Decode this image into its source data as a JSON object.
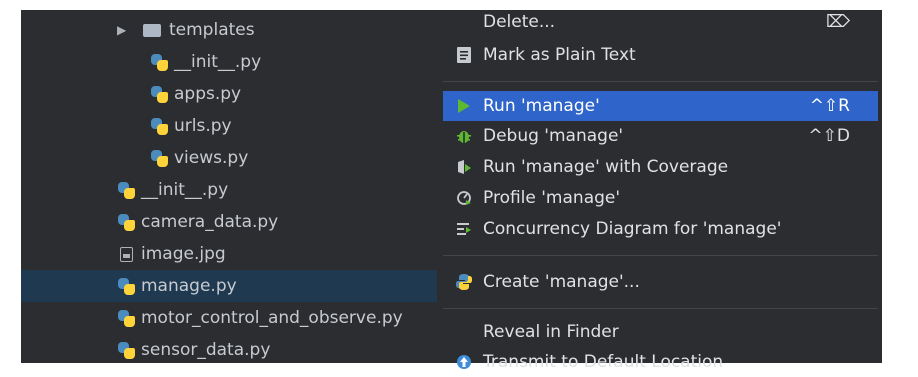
{
  "tree": {
    "items": [
      {
        "label": "templates",
        "type": "folder"
      },
      {
        "label": "__init__.py",
        "type": "py"
      },
      {
        "label": "apps.py",
        "type": "py"
      },
      {
        "label": "urls.py",
        "type": "py"
      },
      {
        "label": "views.py",
        "type": "py"
      },
      {
        "label": "__init__.py",
        "type": "py"
      },
      {
        "label": "camera_data.py",
        "type": "py"
      },
      {
        "label": "image.jpg",
        "type": "image"
      },
      {
        "label": "manage.py",
        "type": "py",
        "selected": true
      },
      {
        "label": "motor_control_and_observe.py",
        "type": "py"
      },
      {
        "label": "sensor_data.py",
        "type": "py"
      }
    ]
  },
  "menu": {
    "items": [
      {
        "label": "Delete...",
        "shortcut": "⌦",
        "icon": "delete-icon"
      },
      {
        "label": "Mark as Plain Text",
        "shortcut": "",
        "icon": "plain-text-icon"
      },
      {
        "label": "Run 'manage'",
        "shortcut": "^⇧R",
        "icon": "run-icon",
        "highlighted": true
      },
      {
        "label": "Debug 'manage'",
        "shortcut": "^⇧D",
        "icon": "debug-icon"
      },
      {
        "label": "Run 'manage' with Coverage",
        "shortcut": "",
        "icon": "coverage-icon"
      },
      {
        "label": "Profile 'manage'",
        "shortcut": "",
        "icon": "profile-icon"
      },
      {
        "label": "Concurrency Diagram for 'manage'",
        "shortcut": "",
        "icon": "concurrency-icon"
      },
      {
        "label": "Create 'manage'...",
        "shortcut": "",
        "icon": "python-icon"
      },
      {
        "label": "Reveal in Finder",
        "shortcut": "",
        "icon": ""
      },
      {
        "label": "Transmit to Default Location",
        "shortcut": "",
        "icon": "transmit-icon"
      }
    ]
  },
  "colors": {
    "highlight": "#2f65ca",
    "selected_row": "#1f3a50",
    "panel": "#2b2d30"
  }
}
